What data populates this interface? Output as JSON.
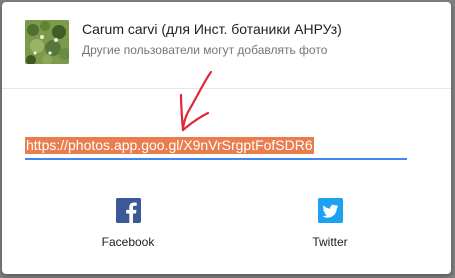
{
  "album": {
    "title": "Carum carvi (для Инст. ботаники АНРУз)",
    "subtitle": "Другие пользователи могут добавлять фото"
  },
  "link": {
    "url": "https://photos.app.goo.gl/X9nVrSrgptFofSDR6"
  },
  "share": {
    "facebook_label": "Facebook",
    "twitter_label": "Twitter",
    "facebook_icon": "facebook-icon",
    "twitter_icon": "twitter-icon"
  },
  "colors": {
    "selection": "#e97d4e",
    "underline": "#4285f4",
    "facebook": "#3b5998",
    "twitter": "#1da1f2",
    "annotation_arrow": "#e0263b"
  }
}
